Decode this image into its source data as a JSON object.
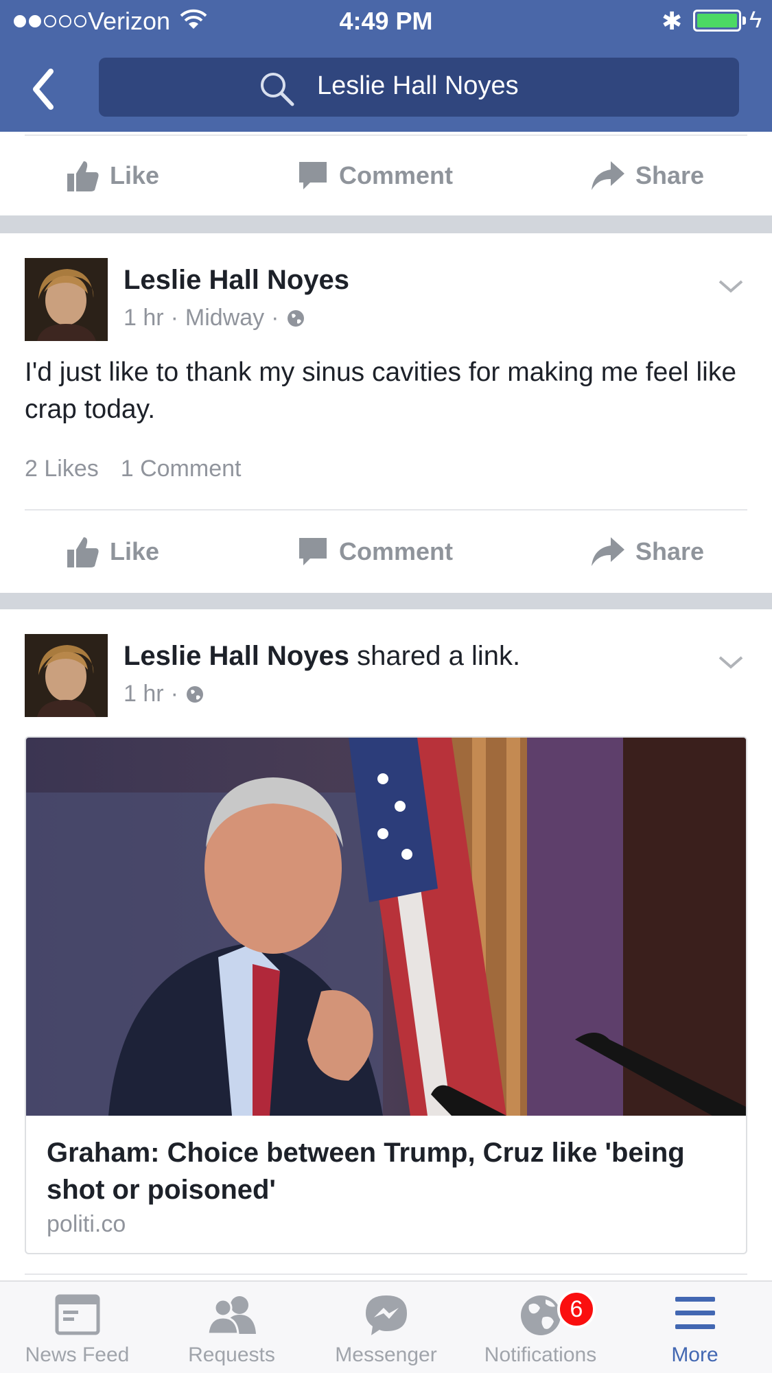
{
  "status_bar": {
    "carrier": "Verizon",
    "time": "4:49 PM",
    "signal_bars": 2,
    "battery_level": 1.0
  },
  "search": {
    "query": "Leslie Hall Noyes",
    "back_icon": "chevron-left-icon",
    "search_icon": "magnifier-icon"
  },
  "actions": {
    "like": "Like",
    "comment": "Comment",
    "share": "Share"
  },
  "post1": {
    "author": "Leslie Hall Noyes",
    "time": "1 hr",
    "location": "Midway",
    "separator": "·",
    "text": "I'd just like to thank my sinus cavities for making me feel like crap today.",
    "likes": "2 Likes",
    "comments": "1 Comment"
  },
  "post2": {
    "author": "Leslie Hall Noyes",
    "action": "shared a link.",
    "time": "1 hr",
    "separator": "·",
    "link_title": "Graham: Choice between Trump, Cruz like 'being shot or poisoned'",
    "link_domain": "politi.co"
  },
  "tabs": [
    {
      "label": "News Feed",
      "icon": "news-feed-icon"
    },
    {
      "label": "Requests",
      "icon": "friends-icon"
    },
    {
      "label": "Messenger",
      "icon": "messenger-icon"
    },
    {
      "label": "Notifications",
      "icon": "globe-icon",
      "badge": "6"
    },
    {
      "label": "More",
      "icon": "menu-icon",
      "active": true
    }
  ],
  "colors": {
    "header": "#4a67a8",
    "search_field": "#30467e",
    "badge": "#fa0f0f",
    "active_tab": "#4267b2"
  }
}
